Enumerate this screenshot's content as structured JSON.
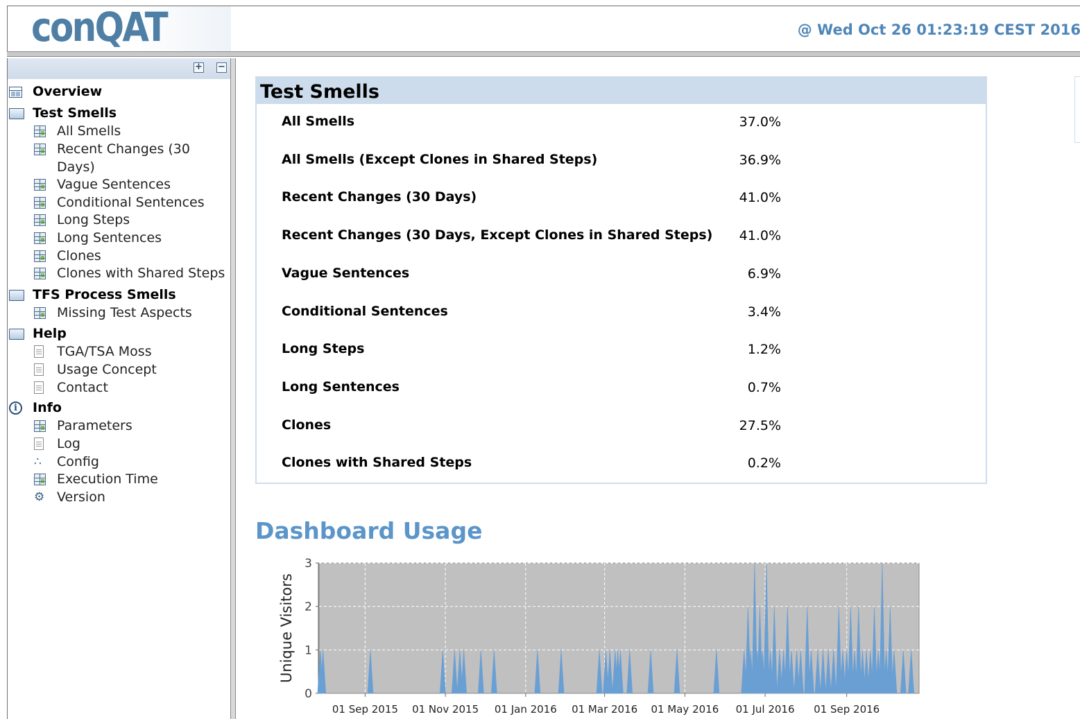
{
  "header": {
    "logo": "conQAT",
    "timestamp": "@ Wed Oct 26 01:23:19 CEST 2016"
  },
  "sidebar": {
    "expand_all": "+",
    "collapse_all": "−",
    "items": [
      {
        "label": "Overview",
        "level": 0,
        "icon": "overview-icon"
      },
      {
        "label": "Test Smells",
        "level": 0,
        "icon": "folder-icon"
      },
      {
        "label": "All Smells",
        "level": 1,
        "icon": "table-icon"
      },
      {
        "label": "Recent Changes (30",
        "label2": "Days)",
        "level": 1,
        "icon": "table-icon"
      },
      {
        "label": "Vague Sentences",
        "level": 1,
        "icon": "table-icon"
      },
      {
        "label": "Conditional Sentences",
        "level": 1,
        "icon": "table-icon"
      },
      {
        "label": "Long Steps",
        "level": 1,
        "icon": "table-icon"
      },
      {
        "label": "Long Sentences",
        "level": 1,
        "icon": "table-icon"
      },
      {
        "label": "Clones",
        "level": 1,
        "icon": "table-icon"
      },
      {
        "label": "Clones with Shared Steps",
        "level": 1,
        "icon": "table-icon"
      },
      {
        "label": "TFS Process Smells",
        "level": 0,
        "icon": "folder-icon"
      },
      {
        "label": "Missing Test Aspects",
        "level": 1,
        "icon": "table-icon"
      },
      {
        "label": "Help",
        "level": 0,
        "icon": "folder-icon"
      },
      {
        "label": "TGA/TSA Moss",
        "level": 1,
        "icon": "document-icon"
      },
      {
        "label": "Usage Concept",
        "level": 1,
        "icon": "document-icon"
      },
      {
        "label": "Contact",
        "level": 1,
        "icon": "document-icon"
      },
      {
        "label": "Info",
        "level": 0,
        "icon": "info-icon"
      },
      {
        "label": "Parameters",
        "level": 1,
        "icon": "table-icon"
      },
      {
        "label": "Log",
        "level": 1,
        "icon": "log-icon"
      },
      {
        "label": "Config",
        "level": 1,
        "icon": "config-icon"
      },
      {
        "label": "Execution Time",
        "level": 1,
        "icon": "execution-time-icon"
      },
      {
        "label": "Version",
        "level": 1,
        "icon": "version-icon"
      }
    ]
  },
  "smells": {
    "title": "Test Smells",
    "rows": [
      {
        "name": "All Smells",
        "value": "37.0%"
      },
      {
        "name": "All Smells (Except Clones in Shared Steps)",
        "value": "36.9%"
      },
      {
        "name": "Recent Changes (30 Days)",
        "value": "41.0%"
      },
      {
        "name": "Recent Changes (30 Days, Except Clones in Shared Steps)",
        "value": "41.0%"
      },
      {
        "name": "Vague Sentences",
        "value": "6.9%"
      },
      {
        "name": "Conditional Sentences",
        "value": "3.4%"
      },
      {
        "name": "Long Steps",
        "value": "1.2%"
      },
      {
        "name": "Long Sentences",
        "value": "0.7%"
      },
      {
        "name": "Clones",
        "value": "27.5%"
      },
      {
        "name": "Clones with Shared Steps",
        "value": "0.2%"
      }
    ]
  },
  "usage": {
    "heading": "Dashboard Usage"
  },
  "chart_data": {
    "type": "area",
    "title": "",
    "xlabel": "",
    "ylabel": "Unique Visitors",
    "ylim": [
      0,
      3
    ],
    "yticks": [
      0,
      1,
      2,
      3
    ],
    "xlim": [
      "2015-07-28",
      "2016-10-26"
    ],
    "xticks": [
      "2015-09-01",
      "2015-11-01",
      "2016-01-01",
      "2016-03-01",
      "2016-05-01",
      "2016-07-01",
      "2016-09-01"
    ],
    "xtick_labels": [
      "01 Sep 2015",
      "01 Nov 2015",
      "01 Jan 2016",
      "01 Mar 2016",
      "01 May 2016",
      "01 Jul 2016",
      "01 Sep 2016"
    ],
    "grid": true,
    "background": "#c0c0c0",
    "color": "#6a9fd4",
    "series": [
      {
        "x": [
          "2015-07-29",
          "2015-07-31",
          "2015-09-05",
          "2015-10-30",
          "2015-11-08",
          "2015-11-12",
          "2015-11-15",
          "2015-11-28",
          "2015-12-08",
          "2016-01-10",
          "2016-01-28",
          "2016-02-26",
          "2016-03-02",
          "2016-03-05",
          "2016-03-09",
          "2016-03-11",
          "2016-03-13",
          "2016-03-20",
          "2016-04-05",
          "2016-04-25",
          "2016-05-25",
          "2016-06-15",
          "2016-06-18",
          "2016-06-20",
          "2016-06-23",
          "2016-06-25",
          "2016-06-27",
          "2016-06-29",
          "2016-07-02",
          "2016-07-05",
          "2016-07-08",
          "2016-07-12",
          "2016-07-15",
          "2016-07-18",
          "2016-07-21",
          "2016-07-25",
          "2016-07-28",
          "2016-08-02",
          "2016-08-05",
          "2016-08-10",
          "2016-08-14",
          "2016-08-18",
          "2016-08-22",
          "2016-08-26",
          "2016-08-29",
          "2016-09-01",
          "2016-09-04",
          "2016-09-07",
          "2016-09-10",
          "2016-09-13",
          "2016-09-16",
          "2016-09-19",
          "2016-09-22",
          "2016-09-25",
          "2016-09-28",
          "2016-10-01",
          "2016-10-04",
          "2016-10-07",
          "2016-10-14",
          "2016-10-20"
        ],
        "y": [
          1,
          1,
          1,
          1,
          1,
          1,
          1,
          1,
          1,
          1,
          1,
          1,
          1,
          1,
          1,
          1,
          1,
          1,
          1,
          1,
          1,
          1,
          2,
          1,
          3,
          1,
          2,
          1,
          3,
          1,
          2,
          1,
          1,
          2,
          1,
          1,
          1,
          2,
          1,
          1,
          1,
          1,
          1,
          2,
          1,
          1,
          2,
          1,
          2,
          1,
          1,
          1,
          2,
          1,
          3,
          1,
          2,
          1,
          1,
          1
        ]
      }
    ]
  }
}
